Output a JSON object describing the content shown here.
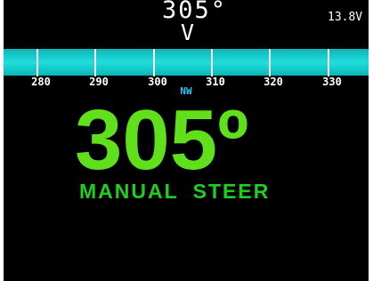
{
  "top_bar": {
    "heading": "305°",
    "pointer": "V",
    "voltage": "13.8V"
  },
  "compass": {
    "ticks": [
      "280",
      "290",
      "300",
      "310",
      "320",
      "330"
    ],
    "cardinal": "NW"
  },
  "main": {
    "heading": "305º",
    "mode": "MANUAL STEER"
  },
  "colors": {
    "background": "#000000",
    "compass_band": "#1ccfcf",
    "heading": "#5fe01a",
    "mode": "#1ed01e",
    "cardinal": "#26c7ff"
  }
}
